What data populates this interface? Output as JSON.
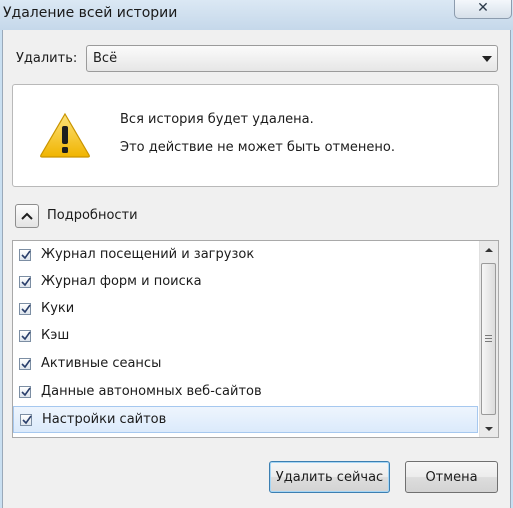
{
  "window": {
    "title": "Удаление всей истории",
    "close_glyph": "✕"
  },
  "range": {
    "label": "Удалить:",
    "value": "Всё"
  },
  "warning": {
    "line1": "Вся история будет удалена.",
    "line2": "Это действие не может быть отменено."
  },
  "details": {
    "label": "Подробности",
    "items": [
      {
        "label": "Журнал посещений и загрузок",
        "checked": true
      },
      {
        "label": "Журнал форм и поиска",
        "checked": true
      },
      {
        "label": "Куки",
        "checked": true
      },
      {
        "label": "Кэш",
        "checked": true
      },
      {
        "label": "Активные сеансы",
        "checked": true
      },
      {
        "label": "Данные автономных веб-сайтов",
        "checked": true
      },
      {
        "label": "Настройки сайтов",
        "checked": true
      }
    ]
  },
  "buttons": {
    "delete_now": "Удалить сейчас",
    "cancel": "Отмена"
  },
  "colors": {
    "titlebar": "#c9dff1",
    "client_bg": "#f0f0f0",
    "selection": "#dbeafb",
    "warning_yellow": "#f5c400"
  }
}
